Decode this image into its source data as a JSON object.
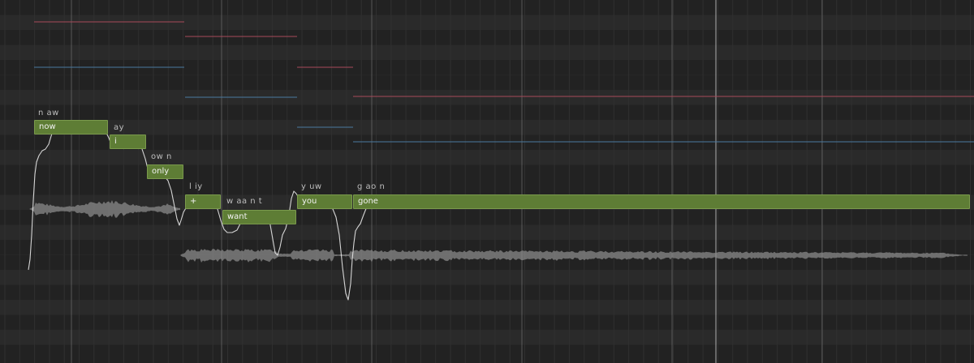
{
  "editor": {
    "colors": {
      "background": "#262626",
      "note_fill": "#5e7d35",
      "note_border": "#7a9a4c",
      "pitch_curve": "#e8e8e8",
      "waveform": "#8a8a8a",
      "red_line": "#a84a5a",
      "blue_line": "#4a7aa0",
      "bar_line": "#9a9a9a"
    }
  },
  "notes": [
    {
      "lyric": "now",
      "phonemes": "n aw"
    },
    {
      "lyric": "i",
      "phonemes": "ay"
    },
    {
      "lyric": "only",
      "phonemes": "ow n"
    },
    {
      "lyric": "+",
      "phonemes": "l iy"
    },
    {
      "lyric": "want",
      "phonemes": "w aa n t"
    },
    {
      "lyric": "you",
      "phonemes": "y uw"
    },
    {
      "lyric": "gone",
      "phonemes": "g ao n"
    }
  ]
}
